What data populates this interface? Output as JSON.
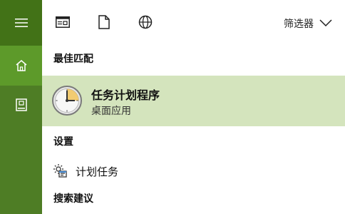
{
  "topbar": {
    "filter_label": "筛选器"
  },
  "sections": {
    "best_match_heading": "最佳匹配",
    "settings_heading": "设置",
    "suggestions_heading": "搜索建议"
  },
  "best_match": {
    "title": "任务计划程序",
    "subtitle": "桌面应用"
  },
  "settings": {
    "items": [
      {
        "label": "计划任务"
      }
    ]
  },
  "icons": {
    "menu": "hamburger-icon",
    "home": "home-icon",
    "notebook": "notebook-icon",
    "apps": "apps-icon",
    "documents": "document-icon",
    "web": "globe-icon",
    "filter_dropdown": "chevron-down-icon",
    "task_scheduler": "clock-icon",
    "setting_item": "gear-icon"
  },
  "colors": {
    "rail": "#4e7d25",
    "rail_selected": "#5d9a2a",
    "best_match_highlight": "#d4e4bd"
  }
}
